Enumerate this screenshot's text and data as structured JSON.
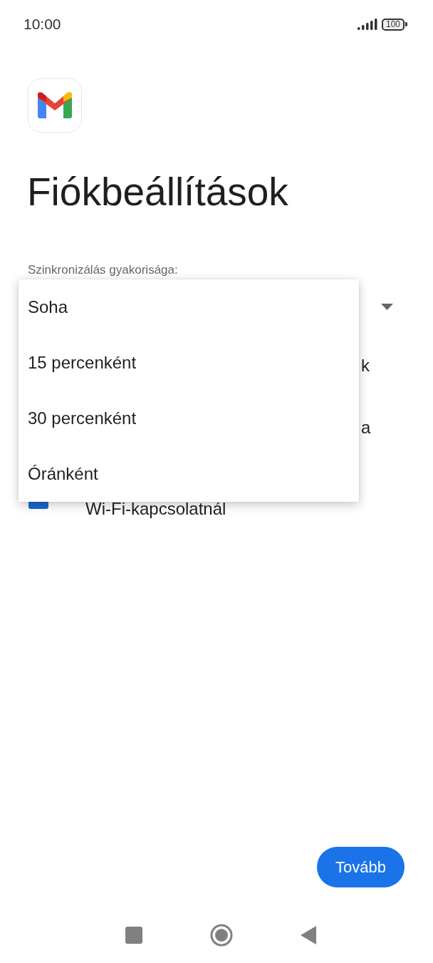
{
  "status_bar": {
    "time": "10:00",
    "battery": "100"
  },
  "title": "Fiókbeállítások",
  "sync_field": {
    "label": "Szinkronizálás gyakorisága:"
  },
  "background_options": [
    {
      "kind": "fragment",
      "text": "k"
    },
    {
      "kind": "fragment",
      "text": "a"
    },
    {
      "kind": "checkbox",
      "checked": true,
      "text": "Wi-Fi-kapcsolatnál"
    }
  ],
  "dropdown_menu": {
    "items": [
      {
        "label": "Soha"
      },
      {
        "label": "15 percenként"
      },
      {
        "label": "30 percenként"
      },
      {
        "label": "Óránként"
      }
    ]
  },
  "next_button": "Tovább"
}
